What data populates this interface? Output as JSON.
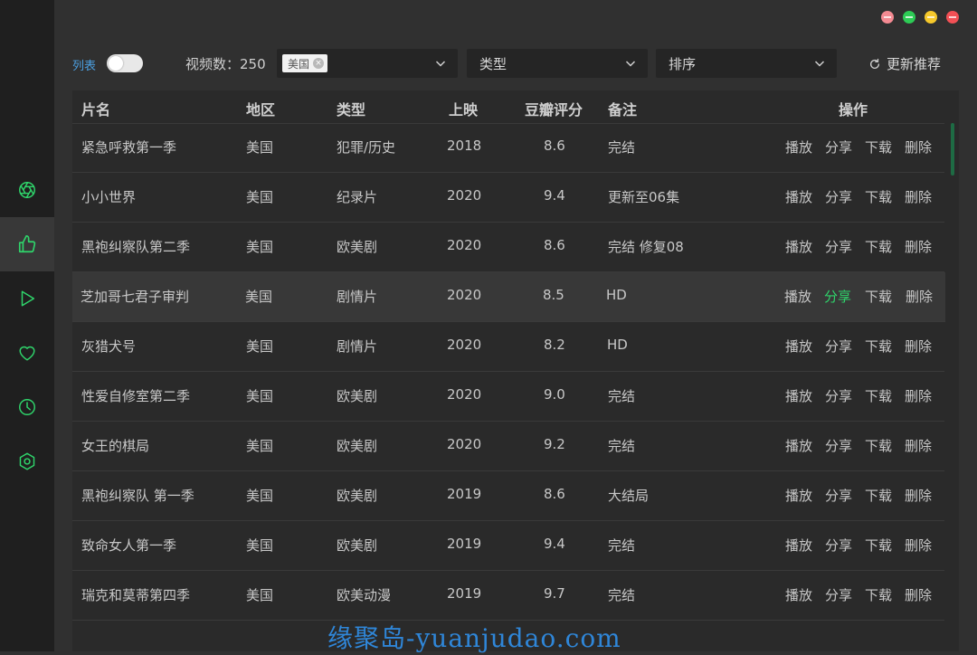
{
  "colors": {
    "accent_green": "#2fd56b",
    "link_blue": "#4b9fe0",
    "win_red": "#f25055",
    "win_yellow": "#f6c82b",
    "win_green": "#2dcb55",
    "win_pink": "#f48a92"
  },
  "sidebar": {
    "items": [
      {
        "icon": "aperture-icon",
        "active": false
      },
      {
        "icon": "thumbs-up-icon",
        "active": true
      },
      {
        "icon": "play-icon",
        "active": false
      },
      {
        "icon": "heart-icon",
        "active": false
      },
      {
        "icon": "clock-icon",
        "active": false
      },
      {
        "icon": "settings-icon",
        "active": false
      }
    ]
  },
  "toolbar": {
    "list_label": "列表",
    "count_text": "视频数：250",
    "region_tag": "美国",
    "type_placeholder": "类型",
    "sort_placeholder": "排序",
    "refresh_label": "更新推荐"
  },
  "table": {
    "headers": {
      "name": "片名",
      "region": "地区",
      "genre": "类型",
      "year": "上映",
      "rating": "豆瓣评分",
      "note": "备注",
      "actions": "操作"
    },
    "action_labels": {
      "play": "播放",
      "share": "分享",
      "download": "下载",
      "delete": "删除"
    },
    "rows": [
      {
        "name": "紧急呼救第一季",
        "region": "美国",
        "genre": "犯罪/历史",
        "year": "2018",
        "rating": "8.6",
        "note": "完结"
      },
      {
        "name": "小小世界",
        "region": "美国",
        "genre": "纪录片",
        "year": "2020",
        "rating": "9.4",
        "note": "更新至06集"
      },
      {
        "name": "黑袍纠察队第二季",
        "region": "美国",
        "genre": "欧美剧",
        "year": "2020",
        "rating": "8.6",
        "note": "完结 修复08"
      },
      {
        "name": "芝加哥七君子审判",
        "region": "美国",
        "genre": "剧情片",
        "year": "2020",
        "rating": "8.5",
        "note": "HD"
      },
      {
        "name": "灰猎犬号",
        "region": "美国",
        "genre": "剧情片",
        "year": "2020",
        "rating": "8.2",
        "note": "HD"
      },
      {
        "name": "性爱自修室第二季",
        "region": "美国",
        "genre": "欧美剧",
        "year": "2020",
        "rating": "9.0",
        "note": "完结"
      },
      {
        "name": "女王的棋局",
        "region": "美国",
        "genre": "欧美剧",
        "year": "2020",
        "rating": "9.2",
        "note": "完结"
      },
      {
        "name": "黑袍纠察队 第一季",
        "region": "美国",
        "genre": "欧美剧",
        "year": "2019",
        "rating": "8.6",
        "note": "大结局"
      },
      {
        "name": "致命女人第一季",
        "region": "美国",
        "genre": "欧美剧",
        "year": "2019",
        "rating": "9.4",
        "note": "完结"
      },
      {
        "name": "瑞克和莫蒂第四季",
        "region": "美国",
        "genre": "欧美动漫",
        "year": "2019",
        "rating": "9.7",
        "note": "完结"
      }
    ]
  },
  "watermark": "缘聚岛-yuanjudao.com"
}
